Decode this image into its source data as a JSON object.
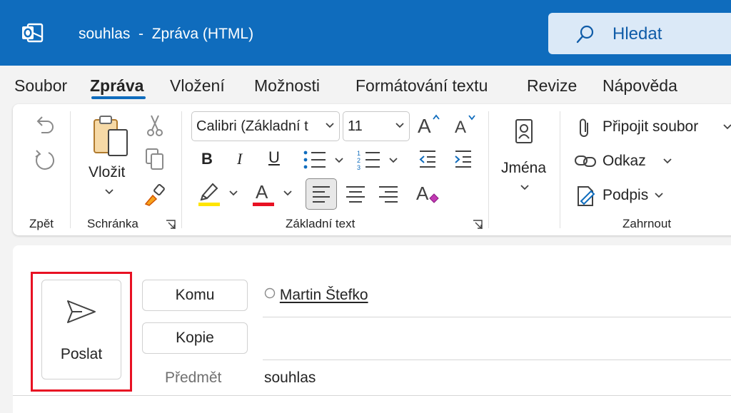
{
  "window": {
    "title": "souhlas  -  Zpráva (HTML)",
    "search_label": "Hledat"
  },
  "menu": {
    "tabs": [
      {
        "label": "Soubor",
        "active": false
      },
      {
        "label": "Zpráva",
        "active": true
      },
      {
        "label": "Vložení",
        "active": false
      },
      {
        "label": "Možnosti",
        "active": false
      },
      {
        "label": "Formátování textu",
        "active": false
      },
      {
        "label": "Revize",
        "active": false
      },
      {
        "label": "Nápověda",
        "active": false
      }
    ]
  },
  "ribbon": {
    "undo_group": {
      "label": "Zpět"
    },
    "clipboard_group": {
      "label": "Schránka",
      "paste_label": "Vložit"
    },
    "basic_text_group": {
      "label": "Základní text",
      "font_name": "Calibri (Základní t",
      "font_size": "11",
      "highlight_color": "#ffe500",
      "font_color": "#e81123"
    },
    "names_group": {
      "names_label": "Jména"
    },
    "include_group": {
      "label": "Zahrnout",
      "attach_label": "Připojit soubor",
      "link_label": "Odkaz",
      "signature_label": "Podpis"
    }
  },
  "compose": {
    "send_label": "Poslat",
    "to_label": "Komu",
    "cc_label": "Kopie",
    "subject_label": "Předmět",
    "recipient": "Martin Štefko",
    "subject_value": "souhlas"
  },
  "colors": {
    "accent": "#0f6cbd",
    "highlight_frame": "#e81123"
  }
}
